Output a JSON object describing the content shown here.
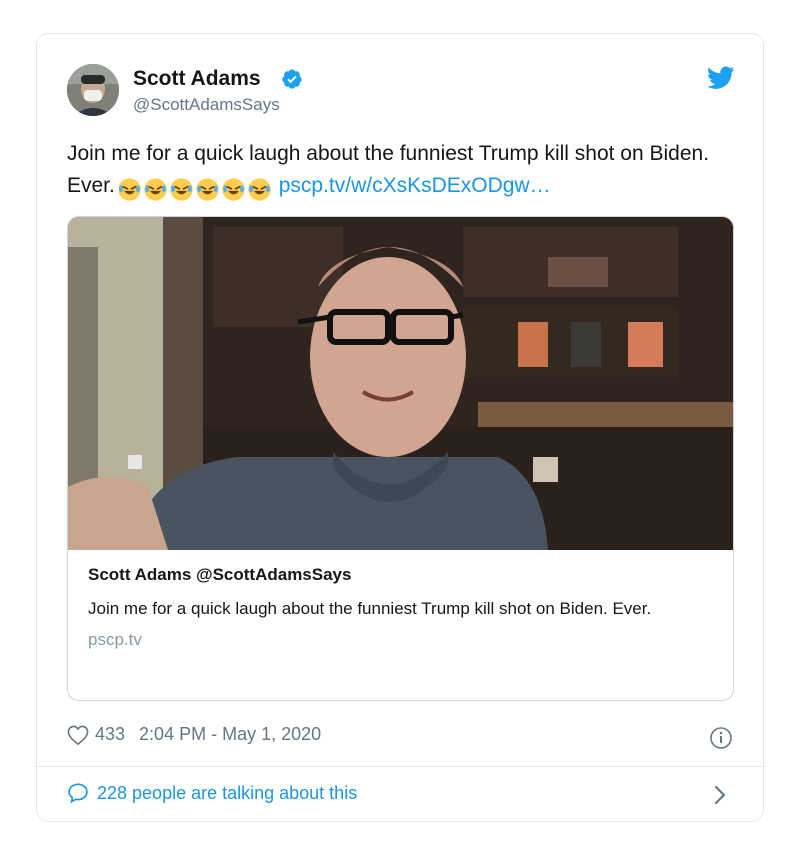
{
  "tweet": {
    "author_name": "Scott Adams",
    "author_handle": "@ScottAdamsSays",
    "text_before_emoji": "Join me for a quick laugh about the funniest Trump kill shot on Biden. Ever.",
    "emoji_count": 6,
    "link_text": "pscp.tv/w/cXsKsDExODgw…",
    "icons": {
      "verified": "verified-badge-icon",
      "brand": "twitter-bird-icon",
      "like": "heart-icon",
      "info": "info-icon",
      "reply": "speech-bubble-icon",
      "more": "chevron-right-icon"
    },
    "colors": {
      "accent": "#1da1f2",
      "link": "#1b95e0",
      "muted": "#657786"
    }
  },
  "card": {
    "title": "Scott Adams @ScottAdamsSays",
    "description": "Join me for a quick laugh about the funniest Trump kill shot on Biden. Ever.",
    "domain": "pscp.tv"
  },
  "footer": {
    "likes": "433",
    "timestamp": "2:04 PM - May 1, 2020",
    "talking": "228 people are talking about this"
  }
}
